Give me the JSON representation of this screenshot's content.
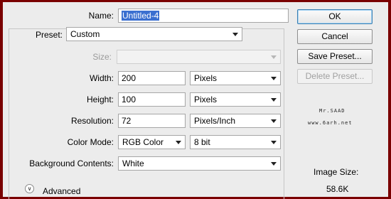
{
  "name": {
    "label": "Name:",
    "value": "Untitled-4"
  },
  "preset": {
    "label": "Preset:",
    "value": "Custom"
  },
  "size": {
    "label": "Size:",
    "value": ""
  },
  "width": {
    "label": "Width:",
    "value": "200",
    "unit": "Pixels"
  },
  "height": {
    "label": "Height:",
    "value": "100",
    "unit": "Pixels"
  },
  "resolution": {
    "label": "Resolution:",
    "value": "72",
    "unit": "Pixels/Inch"
  },
  "color_mode": {
    "label": "Color Mode:",
    "value": "RGB Color",
    "depth": "8 bit"
  },
  "background": {
    "label": "Background Contents:",
    "value": "White"
  },
  "advanced": {
    "label": "Advanced"
  },
  "buttons": {
    "ok": "OK",
    "cancel": "Cancel",
    "save_preset": "Save Preset...",
    "delete_preset": "Delete Preset..."
  },
  "watermark": {
    "line1": "Mr.SAAD",
    "line2": "www.6arh.net"
  },
  "image_size": {
    "label": "Image Size:",
    "value": "58.6K"
  },
  "colors": {
    "frame": "#7a0000",
    "dialog_bg": "#ececec",
    "selection": "#3a6fd0"
  },
  "icons": {
    "dropdown": "chevron-down-icon",
    "advanced_toggle": "double-chevron-down-icon"
  }
}
